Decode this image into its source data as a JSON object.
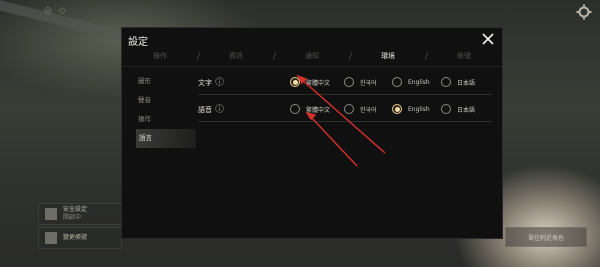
{
  "dialog": {
    "title": "設定",
    "tabs": [
      {
        "label": "操作",
        "active": false
      },
      {
        "label": "資訊",
        "active": false
      },
      {
        "label": "通知",
        "active": false
      },
      {
        "label": "環境",
        "active": true
      },
      {
        "label": "帳號",
        "active": false
      }
    ],
    "sidebar": [
      {
        "label": "圖形",
        "active": false
      },
      {
        "label": "聲音",
        "active": false
      },
      {
        "label": "操作",
        "active": false
      },
      {
        "label": "語言",
        "active": true
      }
    ],
    "rows": [
      {
        "label": "文字",
        "options": [
          {
            "label": "繁體中文",
            "selected": true
          },
          {
            "label": "한국어",
            "selected": false
          },
          {
            "label": "English",
            "selected": false
          },
          {
            "label": "日本語",
            "selected": false
          }
        ]
      },
      {
        "label": "語音",
        "options": [
          {
            "label": "繁體中文",
            "selected": false
          },
          {
            "label": "한국어",
            "selected": false
          },
          {
            "label": "English",
            "selected": true
          },
          {
            "label": "日本語",
            "selected": false
          }
        ]
      }
    ]
  },
  "background": {
    "left_buttons": [
      {
        "line1": "安全設定",
        "line2": "開啟中"
      },
      {
        "line1": "變更帳號",
        "line2": ""
      }
    ],
    "right_button": "單往附近角色"
  },
  "colors": {
    "accent_selected": "#f2dca8",
    "annotation_arrow": "#d9302a"
  },
  "icons": {
    "close": "close-icon",
    "settings": "gear-icon",
    "info": "info-icon"
  }
}
